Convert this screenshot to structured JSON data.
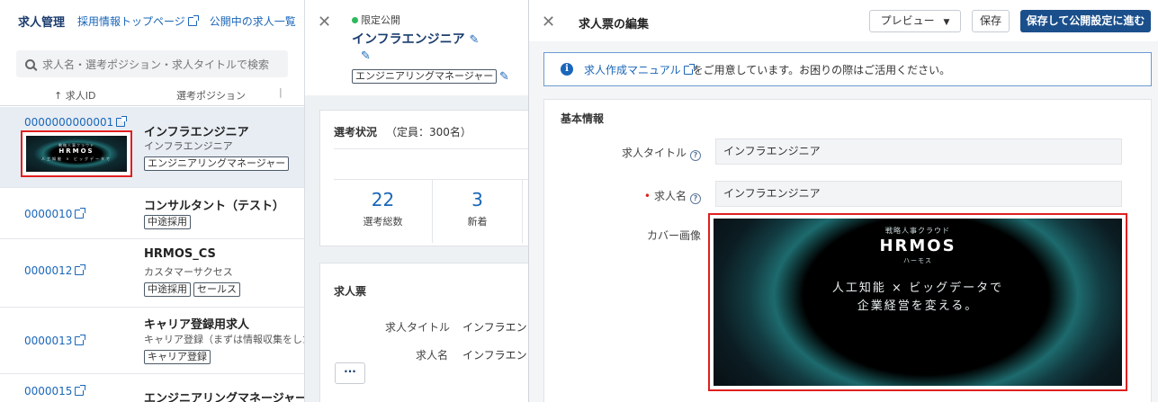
{
  "left": {
    "title": "求人管理",
    "nav_top_page": "採用情報トップページ",
    "nav_public_list": "公開中の求人一覧",
    "search_placeholder": "求人名・選考ポジション・求人タイトルで検索",
    "col_id": "↑ 求人ID",
    "col_position": "選考ポジション",
    "col_sep": "|",
    "rows": [
      {
        "id": "0000000000001",
        "name": "インフラエンジニア",
        "sub": "インフラエンジニア",
        "tags": [
          "エンジニアリングマネージャー"
        ]
      },
      {
        "id": "0000010",
        "name": "コンサルタント（テスト）",
        "sub": "",
        "tags": [
          "中途採用"
        ]
      },
      {
        "id": "0000012",
        "name": "HRMOS_CS",
        "sub": "カスタマーサクセス",
        "tags": [
          "中途採用",
          "セールス"
        ]
      },
      {
        "id": "0000013",
        "name": "キャリア登録用求人",
        "sub": "キャリア登録（まずは情報収集をしたい",
        "tags": [
          "キャリア登録"
        ]
      },
      {
        "id": "0000015",
        "name": "エンジニアリングマネージャー",
        "sub": "",
        "tags": []
      }
    ]
  },
  "mid": {
    "status": "限定公開",
    "title": "インフラエンジニア",
    "tag": "エンジニアリングマネージャー",
    "selection_title": "選考状況",
    "capacity": "（定員：300名）",
    "stats": [
      {
        "value": "22",
        "label": "選考総数"
      },
      {
        "value": "3",
        "label": "新着"
      }
    ],
    "job_title": "求人票",
    "fields": [
      {
        "key": "求人タイトル",
        "value": "インフラエンジ"
      },
      {
        "key": "求人名",
        "value": "インフラエンジ"
      }
    ],
    "more": "···"
  },
  "right": {
    "title": "求人票の編集",
    "preview": "プレビュー",
    "save": "保存",
    "publish": "保存して公開設定に進む",
    "banner_link": "求人作成マニュアル",
    "banner_text": "をご用意しています。お困りの際はご活用ください。",
    "section": "基本情報",
    "label_title": "求人タイトル",
    "value_title": "インフラエンジニア",
    "label_name": "求人名",
    "value_name": "インフラエンジニア",
    "label_cover": "カバー画像",
    "cover": {
      "small": "戦略人事クラウド",
      "logo": "HRMOS",
      "logo_sub": "ハーモス",
      "copy1": "人工知能 × ビッグデータで",
      "copy2": "企業経営を変える。"
    }
  }
}
